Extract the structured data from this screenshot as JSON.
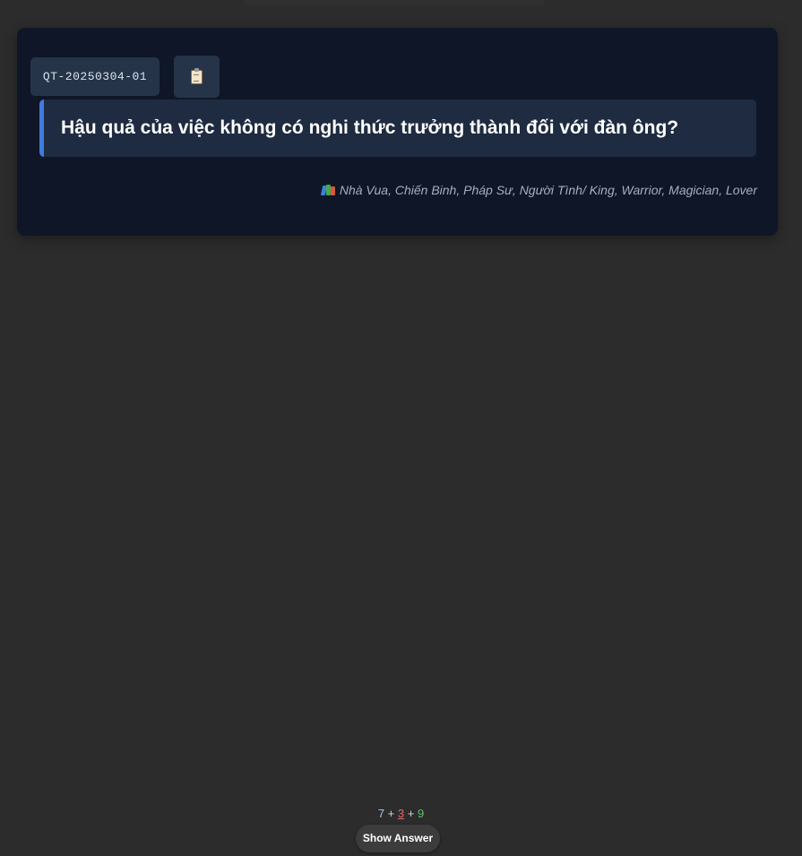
{
  "card": {
    "id": "QT-20250304-01",
    "copy_icon": "clipboard-icon",
    "question": "Hậu quả của việc không có nghi thức trưởng thành đối với đàn ông?",
    "source_icon": "books-icon",
    "source": "Nhà Vua, Chiến Binh, Pháp Sư, Người Tình/ King, Warrior, Magician, Lover"
  },
  "review_bar": {
    "new_count": "7",
    "separator_1": " + ",
    "learn_count": "3",
    "separator_2": " + ",
    "review_count": "9",
    "show_answer_label": "Show Answer"
  },
  "colors": {
    "background": "#2c2c2c",
    "card_background": "#0e1627",
    "accent": "#3d7be0",
    "new_count": "#a8c3e8",
    "learn_count": "#e66767",
    "review_count": "#5cc46d"
  }
}
